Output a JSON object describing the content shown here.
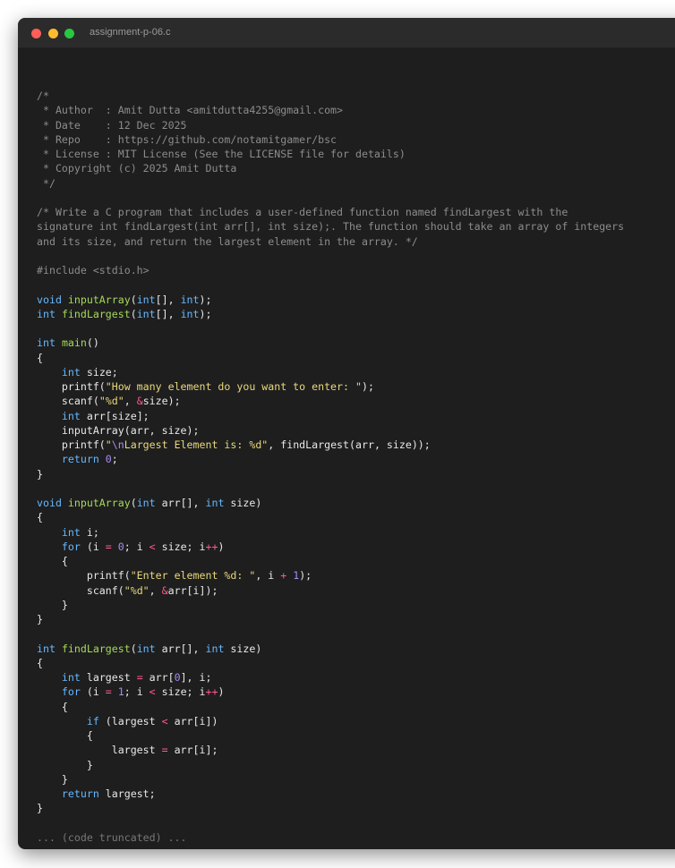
{
  "window": {
    "title": "assignment-p-06.c"
  },
  "code": {
    "lines": [
      [
        {
          "t": "/*",
          "c": "cm"
        }
      ],
      [
        {
          "t": " * Author  : Amit Dutta <amitdutta4255@gmail.com>",
          "c": "cm"
        }
      ],
      [
        {
          "t": " * Date    : 12 Dec 2025",
          "c": "cm"
        }
      ],
      [
        {
          "t": " * Repo    : https://github.com/notamitgamer/bsc",
          "c": "cm"
        }
      ],
      [
        {
          "t": " * License : MIT License (See the LICENSE file for details)",
          "c": "cm"
        }
      ],
      [
        {
          "t": " * Copyright (c) 2025 Amit Dutta",
          "c": "cm"
        }
      ],
      [
        {
          "t": " */",
          "c": "cm"
        }
      ],
      [],
      [
        {
          "t": "/* Write a C program that includes a user-defined function named findLargest with the",
          "c": "cm"
        }
      ],
      [
        {
          "t": "signature int findLargest(int arr[], int size);. The function should take an array of integers",
          "c": "cm"
        }
      ],
      [
        {
          "t": "and its size, and return the largest element in the array. */",
          "c": "cm"
        }
      ],
      [],
      [
        {
          "t": "#include <stdio.h>",
          "c": "pp"
        }
      ],
      [],
      [
        {
          "t": "void",
          "c": "kw"
        },
        {
          "t": " "
        },
        {
          "t": "inputArray",
          "c": "fn"
        },
        {
          "t": "("
        },
        {
          "t": "int",
          "c": "kw"
        },
        {
          "t": "[], "
        },
        {
          "t": "int",
          "c": "kw"
        },
        {
          "t": ");"
        }
      ],
      [
        {
          "t": "int",
          "c": "kw"
        },
        {
          "t": " "
        },
        {
          "t": "findLargest",
          "c": "fn"
        },
        {
          "t": "("
        },
        {
          "t": "int",
          "c": "kw"
        },
        {
          "t": "[], "
        },
        {
          "t": "int",
          "c": "kw"
        },
        {
          "t": ");"
        }
      ],
      [],
      [
        {
          "t": "int",
          "c": "kw"
        },
        {
          "t": " "
        },
        {
          "t": "main",
          "c": "fn"
        },
        {
          "t": "()"
        }
      ],
      [
        {
          "t": "{"
        }
      ],
      [
        {
          "t": "    "
        },
        {
          "t": "int",
          "c": "kw"
        },
        {
          "t": " size;"
        }
      ],
      [
        {
          "t": "    printf("
        },
        {
          "t": "\"How many element do you want to enter: \"",
          "c": "str"
        },
        {
          "t": ");"
        }
      ],
      [
        {
          "t": "    scanf("
        },
        {
          "t": "\"%d\"",
          "c": "str"
        },
        {
          "t": ", "
        },
        {
          "t": "&",
          "c": "op"
        },
        {
          "t": "size);"
        }
      ],
      [
        {
          "t": "    "
        },
        {
          "t": "int",
          "c": "kw"
        },
        {
          "t": " arr[size];"
        }
      ],
      [
        {
          "t": "    inputArray(arr, size);"
        }
      ],
      [
        {
          "t": "    printf("
        },
        {
          "t": "\"",
          "c": "str"
        },
        {
          "t": "\\n",
          "c": "esc"
        },
        {
          "t": "Largest Element is: %d\"",
          "c": "str"
        },
        {
          "t": ", findLargest(arr, size));"
        }
      ],
      [
        {
          "t": "    "
        },
        {
          "t": "return",
          "c": "kw"
        },
        {
          "t": " "
        },
        {
          "t": "0",
          "c": "num"
        },
        {
          "t": ";"
        }
      ],
      [
        {
          "t": "}"
        }
      ],
      [],
      [
        {
          "t": "void",
          "c": "kw"
        },
        {
          "t": " "
        },
        {
          "t": "inputArray",
          "c": "fn"
        },
        {
          "t": "("
        },
        {
          "t": "int",
          "c": "kw"
        },
        {
          "t": " arr[], "
        },
        {
          "t": "int",
          "c": "kw"
        },
        {
          "t": " size)"
        }
      ],
      [
        {
          "t": "{"
        }
      ],
      [
        {
          "t": "    "
        },
        {
          "t": "int",
          "c": "kw"
        },
        {
          "t": " i;"
        }
      ],
      [
        {
          "t": "    "
        },
        {
          "t": "for",
          "c": "kw"
        },
        {
          "t": " (i "
        },
        {
          "t": "=",
          "c": "op"
        },
        {
          "t": " "
        },
        {
          "t": "0",
          "c": "num"
        },
        {
          "t": "; i "
        },
        {
          "t": "<",
          "c": "op"
        },
        {
          "t": " size; i"
        },
        {
          "t": "++",
          "c": "op"
        },
        {
          "t": ")"
        }
      ],
      [
        {
          "t": "    {"
        }
      ],
      [
        {
          "t": "        printf("
        },
        {
          "t": "\"Enter element %d: \"",
          "c": "str"
        },
        {
          "t": ", i "
        },
        {
          "t": "+",
          "c": "op"
        },
        {
          "t": " "
        },
        {
          "t": "1",
          "c": "num"
        },
        {
          "t": ");"
        }
      ],
      [
        {
          "t": "        scanf("
        },
        {
          "t": "\"%d\"",
          "c": "str"
        },
        {
          "t": ", "
        },
        {
          "t": "&",
          "c": "op"
        },
        {
          "t": "arr[i]);"
        }
      ],
      [
        {
          "t": "    }"
        }
      ],
      [
        {
          "t": "}"
        }
      ],
      [],
      [
        {
          "t": "int",
          "c": "kw"
        },
        {
          "t": " "
        },
        {
          "t": "findLargest",
          "c": "fn"
        },
        {
          "t": "("
        },
        {
          "t": "int",
          "c": "kw"
        },
        {
          "t": " arr[], "
        },
        {
          "t": "int",
          "c": "kw"
        },
        {
          "t": " size)"
        }
      ],
      [
        {
          "t": "{"
        }
      ],
      [
        {
          "t": "    "
        },
        {
          "t": "int",
          "c": "kw"
        },
        {
          "t": " largest "
        },
        {
          "t": "=",
          "c": "op"
        },
        {
          "t": " arr["
        },
        {
          "t": "0",
          "c": "num"
        },
        {
          "t": "], i;"
        }
      ],
      [
        {
          "t": "    "
        },
        {
          "t": "for",
          "c": "kw"
        },
        {
          "t": " (i "
        },
        {
          "t": "=",
          "c": "op"
        },
        {
          "t": " "
        },
        {
          "t": "1",
          "c": "num"
        },
        {
          "t": "; i "
        },
        {
          "t": "<",
          "c": "op"
        },
        {
          "t": " size; i"
        },
        {
          "t": "++",
          "c": "op"
        },
        {
          "t": ")"
        }
      ],
      [
        {
          "t": "    {"
        }
      ],
      [
        {
          "t": "        "
        },
        {
          "t": "if",
          "c": "kw"
        },
        {
          "t": " (largest "
        },
        {
          "t": "<",
          "c": "op"
        },
        {
          "t": " arr[i])"
        }
      ],
      [
        {
          "t": "        {"
        }
      ],
      [
        {
          "t": "            largest "
        },
        {
          "t": "=",
          "c": "op"
        },
        {
          "t": " arr[i];"
        }
      ],
      [
        {
          "t": "        }"
        }
      ],
      [
        {
          "t": "    }"
        }
      ],
      [
        {
          "t": "    "
        },
        {
          "t": "return",
          "c": "kw"
        },
        {
          "t": " largest;"
        }
      ],
      [
        {
          "t": "}"
        }
      ],
      [],
      [
        {
          "t": "... (code truncated) ...",
          "c": "tr"
        }
      ]
    ]
  }
}
